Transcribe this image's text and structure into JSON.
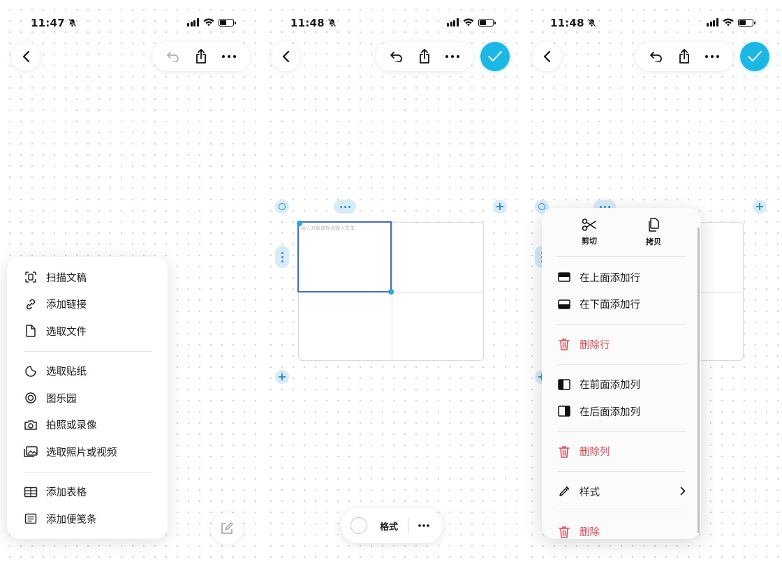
{
  "status": {
    "time_1": "11:47",
    "time_2": "11:48",
    "time_3": "11:48"
  },
  "insert_menu": {
    "groups": [
      [
        "扫描文稿",
        "添加链接",
        "选取文件"
      ],
      [
        "选取贴纸",
        "图乐园",
        "拍照或录像",
        "选取照片或视频"
      ],
      [
        "添加表格",
        "添加便笺条"
      ]
    ],
    "icons": [
      "scan-icon",
      "link-icon",
      "file-icon",
      "sticker-icon",
      "gallery-icon",
      "camera-icon",
      "photos-icon",
      "table-icon",
      "note-icon"
    ]
  },
  "table": {
    "placeholder": "插入对象或轻点输入文本"
  },
  "format_bar": {
    "label": "格式"
  },
  "context_menu": {
    "cut": "剪切",
    "copy": "拷贝",
    "add_row_above": "在上面添加行",
    "add_row_below": "在下面添加行",
    "delete_row": "删除行",
    "add_col_before": "在前面添加列",
    "add_col_after": "在后面添加列",
    "delete_col": "删除列",
    "style": "样式",
    "delete": "删除"
  },
  "colors": {
    "accent": "#1bb8e6",
    "selection": "#3b6fd6",
    "destructive": "#e0484f",
    "control_bg": "#d8ecf7"
  }
}
